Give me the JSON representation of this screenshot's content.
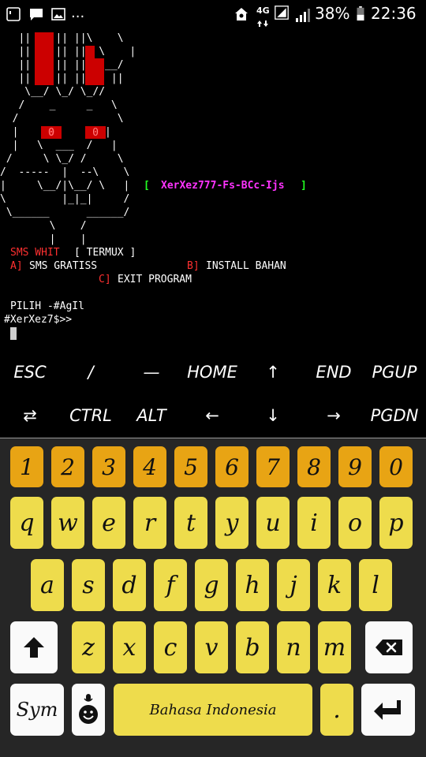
{
  "statusbar": {
    "network": "4G",
    "battery": "38%",
    "time": "22:36",
    "more": "..."
  },
  "terminal": {
    "art_lines": [
      "   ||    || ||\\    \\",
      "   ||    || ||  \\    |",
      "   ||    || ||  \\__/",
      "   ||    || ||    ||",
      "    \\__/ \\_/ \\_//",
      "   /    _     _   \\",
      "  /                \\",
      "  |              |",
      "  |   \\  ___  /   |",
      " /     \\ \\_/ /     \\",
      "/  -----  |  --\\    \\",
      "|     \\__/|\\__/ \\   |",
      "\\         |_|_|     /",
      " \\______      ______/",
      "        \\    /",
      "        |    |"
    ],
    "eye_left": "0",
    "eye_right": "0",
    "banner_open": "[",
    "banner_text": "XerXez777-Fs-BCc-Ijs",
    "banner_close": "]",
    "menu_title": "SMS WHIT",
    "menu_title_tag": "[ TERMUX ]",
    "opt_a_key": "A]",
    "opt_a_label": "SMS GRATISS",
    "opt_b_key": "B]",
    "opt_b_label": "INSTALL BAHAN",
    "opt_c_key": "C]",
    "opt_c_label": "EXIT PROGRAM",
    "prompt_choose": "PILIH -#AgIl",
    "prompt": "#XerXez7$>>"
  },
  "extra_keys": {
    "row1": [
      "ESC",
      "/",
      "—",
      "HOME",
      "↑",
      "END",
      "PGUP"
    ],
    "row2": [
      "⇄",
      "CTRL",
      "ALT",
      "←",
      "↓",
      "→",
      "PGDN"
    ]
  },
  "keyboard": {
    "numbers": [
      "1",
      "2",
      "3",
      "4",
      "5",
      "6",
      "7",
      "8",
      "9",
      "0"
    ],
    "row1": [
      "q",
      "w",
      "e",
      "r",
      "t",
      "y",
      "u",
      "i",
      "o",
      "p"
    ],
    "row2": [
      "a",
      "s",
      "d",
      "f",
      "g",
      "h",
      "j",
      "k",
      "l"
    ],
    "row3": [
      "z",
      "x",
      "c",
      "v",
      "b",
      "n",
      "m"
    ],
    "sym": "Sym",
    "space": "Bahasa Indonesia",
    "period": ".",
    "colors": {
      "number_key": "#e8a414",
      "letter_key": "#eedc4c",
      "background": "#262626"
    }
  }
}
